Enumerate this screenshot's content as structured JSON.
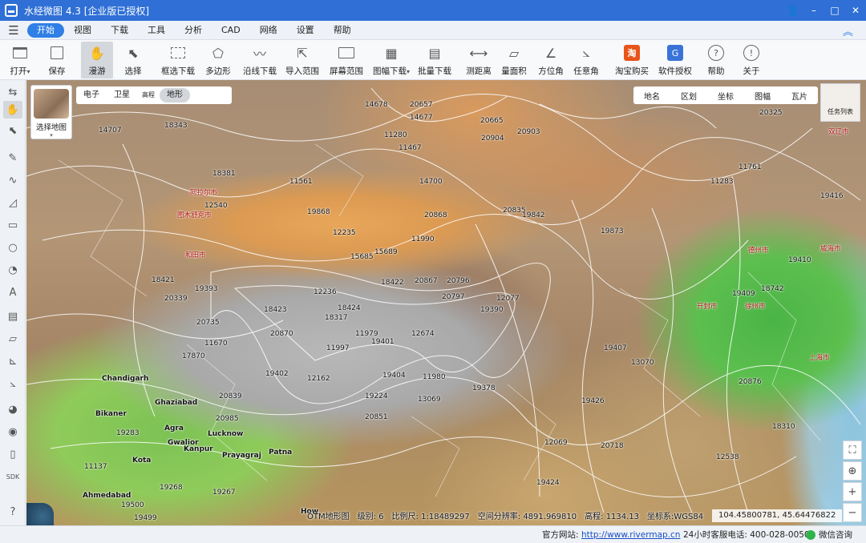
{
  "app": {
    "title": "水经微图 4.3 [企业版已授权]"
  },
  "window_controls": {
    "user": "👤",
    "minimize": "–",
    "maximize": "□",
    "close": "✕"
  },
  "menu": {
    "items": [
      "开始",
      "视图",
      "下载",
      "工具",
      "分析",
      "CAD",
      "网络",
      "设置",
      "帮助"
    ],
    "active_index": 0,
    "collapse_glyph": "︽"
  },
  "toolbar": {
    "open": "打开",
    "open_caret": "▾",
    "save": "保存",
    "pan": "漫游",
    "select": "选择",
    "box_download": "框选下载",
    "polygon": "多边形",
    "line_download": "沿线下载",
    "import_range": "导入范围",
    "screen_range": "屏幕范围",
    "tile_download": "图幅下载",
    "tile_caret": "▾",
    "batch_download": "批量下载",
    "measure_distance": "测距离",
    "measure_area": "量面积",
    "azimuth": "方位角",
    "any_angle": "任意角",
    "taobao": "淘宝购买",
    "taobao_glyph": "淘",
    "license": "软件授权",
    "license_glyph": "G",
    "help": "帮助",
    "help_glyph": "?",
    "about": "关于",
    "about_glyph": "!"
  },
  "map": {
    "layer_switch_label": "选择地图",
    "basemap_tabs": [
      "电子",
      "卫星",
      "高程",
      "地形"
    ],
    "basemap_active_index": 3,
    "overlay_tabs": [
      "地名",
      "区划",
      "坐标",
      "图幅",
      "瓦片"
    ],
    "task_list": "任务列表",
    "labels": [
      {
        "t": "14707",
        "c": "num"
      },
      {
        "t": "18343",
        "c": "num"
      },
      {
        "t": "18381",
        "c": "num"
      },
      {
        "t": "12540",
        "c": "num"
      },
      {
        "t": "19868",
        "c": "num"
      },
      {
        "t": "11561",
        "c": "num"
      },
      {
        "t": "14678",
        "c": "num"
      },
      {
        "t": "20657",
        "c": "num"
      },
      {
        "t": "14677",
        "c": "num"
      },
      {
        "t": "20665",
        "c": "num"
      },
      {
        "t": "20903",
        "c": "num"
      },
      {
        "t": "20904",
        "c": "num"
      },
      {
        "t": "11280",
        "c": "num"
      },
      {
        "t": "11467",
        "c": "num"
      },
      {
        "t": "14700",
        "c": "num"
      },
      {
        "t": "12235",
        "c": "num"
      },
      {
        "t": "15685",
        "c": "num"
      },
      {
        "t": "15689",
        "c": "num"
      },
      {
        "t": "11990",
        "c": "num"
      },
      {
        "t": "20868",
        "c": "num"
      },
      {
        "t": "20835",
        "c": "num"
      },
      {
        "t": "19842",
        "c": "num"
      },
      {
        "t": "19873",
        "c": "num"
      },
      {
        "t": "20325",
        "c": "num"
      },
      {
        "t": "11761",
        "c": "num"
      },
      {
        "t": "11283",
        "c": "num"
      },
      {
        "t": "19416",
        "c": "num"
      },
      {
        "t": "19410",
        "c": "num"
      },
      {
        "t": "18742",
        "c": "num"
      },
      {
        "t": "18421",
        "c": "num"
      },
      {
        "t": "19393",
        "c": "num"
      },
      {
        "t": "20339",
        "c": "num"
      },
      {
        "t": "20735",
        "c": "num"
      },
      {
        "t": "18423",
        "c": "num"
      },
      {
        "t": "12236",
        "c": "num"
      },
      {
        "t": "18424",
        "c": "num"
      },
      {
        "t": "18317",
        "c": "num"
      },
      {
        "t": "18422",
        "c": "num"
      },
      {
        "t": "20867",
        "c": "num"
      },
      {
        "t": "20796",
        "c": "num"
      },
      {
        "t": "20797",
        "c": "num"
      },
      {
        "t": "19390",
        "c": "num"
      },
      {
        "t": "12077",
        "c": "num"
      },
      {
        "t": "20870",
        "c": "num"
      },
      {
        "t": "11979",
        "c": "num"
      },
      {
        "t": "19401",
        "c": "num"
      },
      {
        "t": "12674",
        "c": "num"
      },
      {
        "t": "11997",
        "c": "num"
      },
      {
        "t": "11670",
        "c": "num"
      },
      {
        "t": "17870",
        "c": "num"
      },
      {
        "t": "19402",
        "c": "num"
      },
      {
        "t": "12162",
        "c": "num"
      },
      {
        "t": "19404",
        "c": "num"
      },
      {
        "t": "11980",
        "c": "num"
      },
      {
        "t": "19378",
        "c": "num"
      },
      {
        "t": "19224",
        "c": "num"
      },
      {
        "t": "13069",
        "c": "num"
      },
      {
        "t": "20851",
        "c": "num"
      },
      {
        "t": "20985",
        "c": "num"
      },
      {
        "t": "20839",
        "c": "num"
      },
      {
        "t": "12069",
        "c": "num"
      },
      {
        "t": "20718",
        "c": "num"
      },
      {
        "t": "12538",
        "c": "num"
      },
      {
        "t": "13070",
        "c": "num"
      },
      {
        "t": "19426",
        "c": "num"
      },
      {
        "t": "19407",
        "c": "num"
      },
      {
        "t": "19409",
        "c": "num"
      },
      {
        "t": "20876",
        "c": "num"
      },
      {
        "t": "18310",
        "c": "num"
      },
      {
        "t": "19424",
        "c": "num"
      },
      {
        "t": "19283",
        "c": "num"
      },
      {
        "t": "11137",
        "c": "num"
      },
      {
        "t": "19500",
        "c": "num"
      },
      {
        "t": "19499",
        "c": "num"
      },
      {
        "t": "19268",
        "c": "num"
      },
      {
        "t": "19267",
        "c": "num"
      },
      {
        "t": "Chandigarh",
        "c": "city"
      },
      {
        "t": "Ghaziabad",
        "c": "city"
      },
      {
        "t": "Bikaner",
        "c": "city"
      },
      {
        "t": "Agra",
        "c": "city"
      },
      {
        "t": "Gwalior",
        "c": "city"
      },
      {
        "t": "Kanpur",
        "c": "city"
      },
      {
        "t": "Lucknow",
        "c": "city"
      },
      {
        "t": "Prayagraj",
        "c": "city"
      },
      {
        "t": "Patna",
        "c": "city"
      },
      {
        "t": "Kota",
        "c": "city"
      },
      {
        "t": "Ahmedabad",
        "c": "city"
      },
      {
        "t": "How",
        "c": "city"
      },
      {
        "t": "阿拉尔市",
        "c": "cn"
      },
      {
        "t": "图木舒克市",
        "c": "cn"
      },
      {
        "t": "和田市",
        "c": "cn"
      },
      {
        "t": "双辽市",
        "c": "cn"
      },
      {
        "t": "德州市",
        "c": "cn"
      },
      {
        "t": "开封市",
        "c": "cn"
      },
      {
        "t": "徐州市",
        "c": "cn"
      },
      {
        "t": "威海市",
        "c": "cn"
      },
      {
        "t": "上海市",
        "c": "cn"
      }
    ]
  },
  "map_status": {
    "layer": "OTM地形图",
    "level_label": "级别:",
    "level_value": "6",
    "scale_label": "比例尺:",
    "scale_value": "1:18489297",
    "resolution_label": "空间分辨率:",
    "resolution_value": "4891.969810",
    "elevation_label": "高程:",
    "elevation_value": "1134.13",
    "coord_system": "坐标系:WGS84",
    "coordinates": "104.45800781, 45.64476822"
  },
  "map_controls": {
    "fullscreen": "⛶",
    "locate": "⊕",
    "zoom_in": "+",
    "zoom_out": "−"
  },
  "statusbar": {
    "site_label": "官方网站:",
    "site_url": "http://www.rivermap.cn",
    "phone": "24小时客服电话: 400-028-0050",
    "wechat": "微信咨询"
  },
  "colors": {
    "titlebar": "#2f6fd6",
    "accent": "#2f7fe6",
    "link": "#1a4fc7"
  }
}
